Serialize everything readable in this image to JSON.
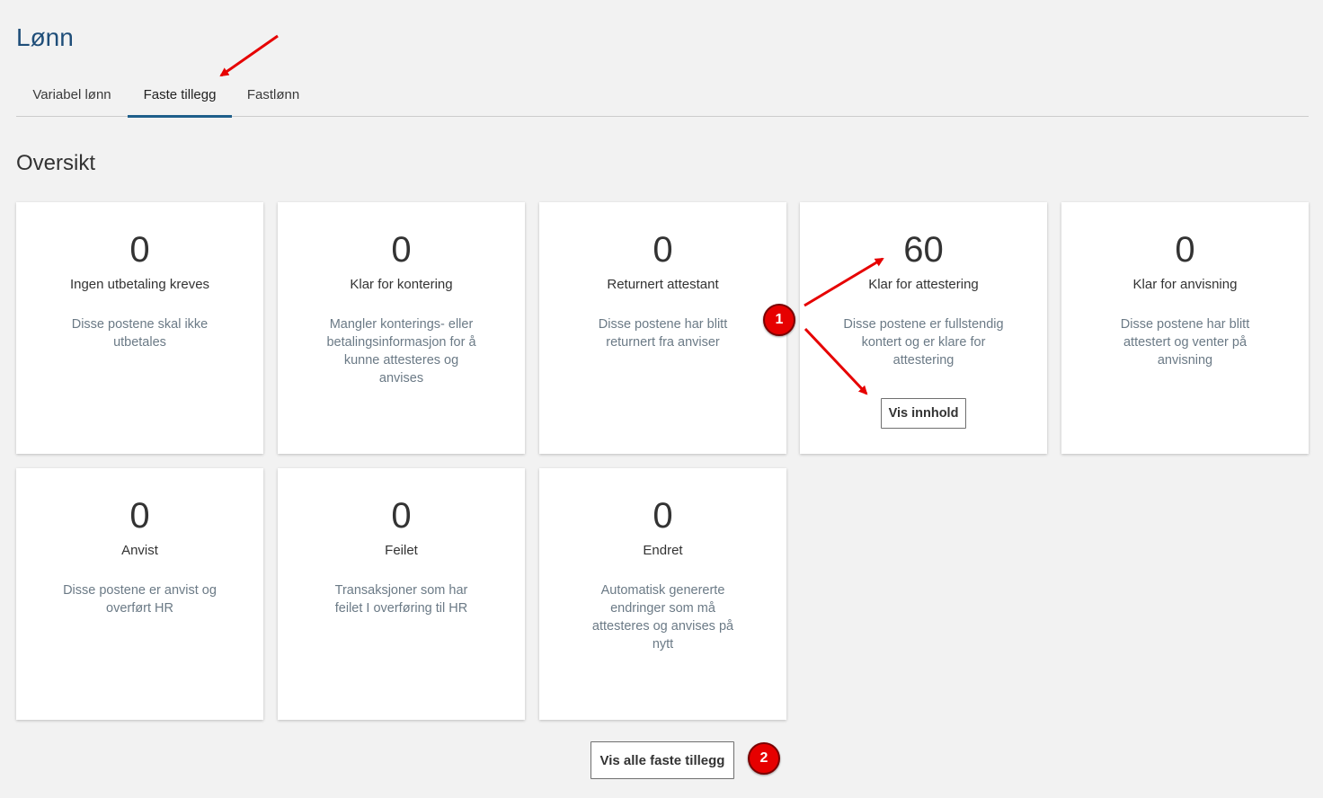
{
  "page": {
    "title": "Lønn"
  },
  "tabs": [
    {
      "label": "Variabel lønn",
      "active": false
    },
    {
      "label": "Faste tillegg",
      "active": true
    },
    {
      "label": "Fastlønn",
      "active": false
    }
  ],
  "overview": {
    "title": "Oversikt",
    "cards": [
      {
        "count": "0",
        "label": "Ingen utbetaling kreves",
        "description": "Disse postene skal ikke utbetales"
      },
      {
        "count": "0",
        "label": "Klar for kontering",
        "description": "Mangler konterings- eller betalingsinformasjon for å kunne attesteres og anvises"
      },
      {
        "count": "0",
        "label": "Returnert attestant",
        "description": "Disse postene har blitt returnert fra anviser"
      },
      {
        "count": "60",
        "label": "Klar for attestering",
        "description": "Disse postene er fullstendig kontert og er klare for attestering",
        "button_label": "Vis innhold"
      },
      {
        "count": "0",
        "label": "Klar for anvisning",
        "description": "Disse postene har blitt attestert og venter på anvisning"
      },
      {
        "count": "0",
        "label": "Anvist",
        "description": "Disse postene er anvist og overført HR"
      },
      {
        "count": "0",
        "label": "Feilet",
        "description": "Transaksjoner som har feilet I overføring til HR"
      },
      {
        "count": "0",
        "label": "Endret",
        "description": "Automatisk genererte endringer som må attesteres og anvises på nytt"
      }
    ]
  },
  "footer": {
    "show_all_label": "Vis alle faste tillegg"
  },
  "annotations": {
    "marker_1": "1",
    "marker_2": "2",
    "color": "#e60000"
  },
  "colors": {
    "title": "#1f4e79",
    "tab_underline": "#1f5f8b",
    "background": "#f2f2f2",
    "card": "#ffffff",
    "description_text": "#6b7a86"
  }
}
